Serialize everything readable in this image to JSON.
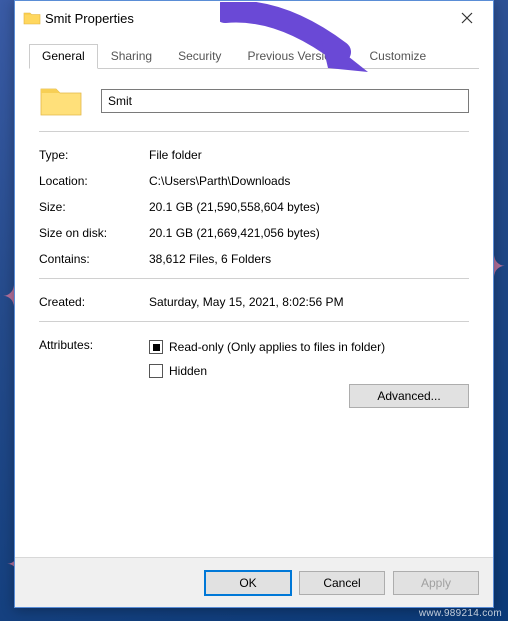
{
  "window": {
    "title": "Smit Properties"
  },
  "tabs": {
    "general": "General",
    "sharing": "Sharing",
    "security": "Security",
    "previous": "Previous Versions",
    "customize": "Customize"
  },
  "general": {
    "name_value": "Smit",
    "labels": {
      "type": "Type:",
      "location": "Location:",
      "size": "Size:",
      "size_on_disk": "Size on disk:",
      "contains": "Contains:",
      "created": "Created:",
      "attributes": "Attributes:"
    },
    "values": {
      "type": "File folder",
      "location": "C:\\Users\\Parth\\Downloads",
      "size": "20.1 GB (21,590,558,604 bytes)",
      "size_on_disk": "20.1 GB (21,669,421,056 bytes)",
      "contains": "38,612 Files, 6 Folders",
      "created": "Saturday, May 15, 2021, 8:02:56 PM"
    },
    "attributes": {
      "readonly_label": "Read-only (Only applies to files in folder)",
      "hidden_label": "Hidden",
      "advanced_btn": "Advanced..."
    }
  },
  "buttons": {
    "ok": "OK",
    "cancel": "Cancel",
    "apply": "Apply"
  },
  "watermark": "www.989214.com"
}
